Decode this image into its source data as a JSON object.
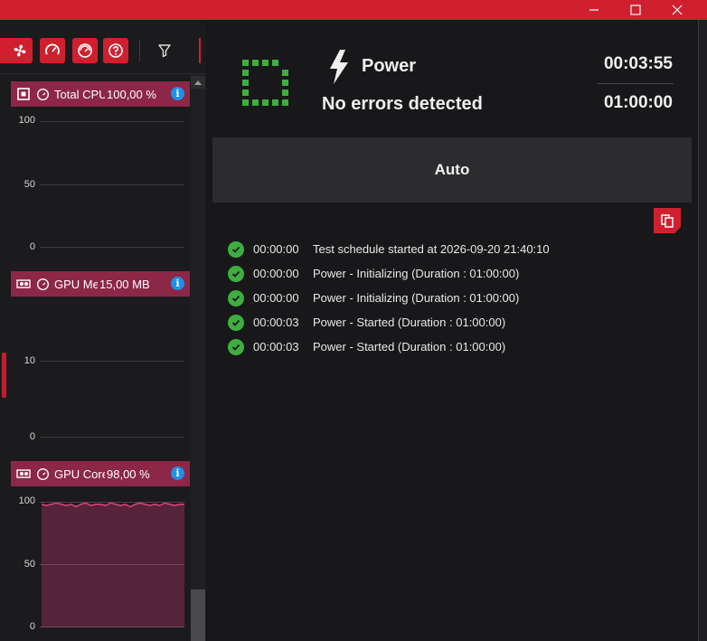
{
  "window": {
    "controls": [
      "minimize-icon",
      "maximize-icon",
      "close-icon"
    ]
  },
  "toolbar": {
    "buttons": [
      "fan-icon",
      "gauge-icon",
      "speedometer-icon",
      "help-icon"
    ],
    "filter_icon": "filter-icon"
  },
  "monitors": [
    {
      "icon": "cpu-icon",
      "label": "Total CPU",
      "value": "100,00 %",
      "ticks": [
        "100",
        "50",
        "0"
      ]
    },
    {
      "icon": "gpu-icon",
      "label": "GPU Memory",
      "value": "15,00 MB",
      "ticks": [
        "10",
        "0"
      ]
    },
    {
      "icon": "gpu-icon",
      "label": "GPU Core",
      "value": "98,00 %",
      "ticks": [
        "100",
        "50",
        "0"
      ],
      "series": [
        98,
        97,
        98,
        99,
        98,
        97,
        98,
        96,
        98,
        99,
        97,
        98,
        98,
        97,
        99,
        98,
        97,
        98,
        96,
        98,
        99,
        98,
        97,
        98,
        97,
        99,
        98,
        97,
        98,
        98
      ]
    }
  ],
  "status": {
    "test_name": "Power",
    "message": "No errors detected",
    "elapsed": "00:03:55",
    "duration": "01:00:00",
    "status_color": "#3fae3f"
  },
  "mode": {
    "label": "Auto"
  },
  "log": [
    {
      "time": "00:00:00",
      "message": "Test schedule started at 2026-09-20 21:40:10"
    },
    {
      "time": "00:00:00",
      "message": "Power - Initializing (Duration : 01:00:00)"
    },
    {
      "time": "00:00:00",
      "message": "Power - Initializing (Duration : 01:00:00)"
    },
    {
      "time": "00:00:03",
      "message": "Power - Started (Duration : 01:00:00)"
    },
    {
      "time": "00:00:03",
      "message": "Power - Started (Duration : 01:00:00)"
    }
  ],
  "colors": {
    "accent": "#d0202f",
    "card_header": "#8c2748",
    "info": "#1e90e6",
    "success": "#3fae3f"
  }
}
